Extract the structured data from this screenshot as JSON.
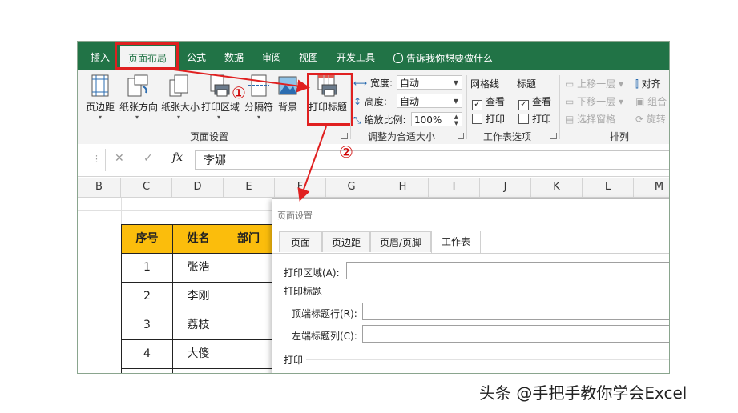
{
  "tabs": [
    {
      "label": "插入"
    },
    {
      "label": "页面布局"
    },
    {
      "label": "公式"
    },
    {
      "label": "数据"
    },
    {
      "label": "审阅"
    },
    {
      "label": "视图"
    },
    {
      "label": "开发工具"
    }
  ],
  "tell_me": "告诉我你想要做什么",
  "ribbon": {
    "page_setup": {
      "buttons": [
        {
          "label": "页边距"
        },
        {
          "label": "纸张方向"
        },
        {
          "label": "纸张大小"
        },
        {
          "label": "打印区域"
        },
        {
          "label": "分隔符"
        },
        {
          "label": "背景"
        },
        {
          "label": "打印标题"
        }
      ],
      "group_label": "页面设置"
    },
    "scale_to_fit": {
      "width_label": "宽度:",
      "width_value": "自动",
      "height_label": "高度:",
      "height_value": "自动",
      "scale_label": "缩放比例:",
      "scale_value": "100%",
      "group_label": "调整为合适大小"
    },
    "sheet_options": {
      "gridlines_label": "网格线",
      "headings_label": "标题",
      "view_label": "查看",
      "print_label": "打印",
      "gridlines_view": true,
      "gridlines_print": false,
      "headings_view": true,
      "headings_print": false,
      "group_label": "工作表选项"
    },
    "arrange": {
      "bring_forward": "上移一层",
      "send_backward": "下移一层",
      "selection_pane": "选择窗格",
      "align": "对齐",
      "group": "组合",
      "rotate": "旋转",
      "group_label": "排列"
    }
  },
  "formula_bar": {
    "cancel_icon": "✕",
    "enter_icon": "✓",
    "fx": "fx",
    "value": "李娜"
  },
  "columns": [
    "B",
    "C",
    "D",
    "E",
    "F",
    "G",
    "H",
    "I",
    "J",
    "K",
    "L",
    "M"
  ],
  "table": {
    "headers": [
      "序号",
      "姓名",
      "部门"
    ],
    "rows": [
      [
        "1",
        "张浩",
        ""
      ],
      [
        "2",
        "李刚",
        ""
      ],
      [
        "3",
        "荔枝",
        ""
      ],
      [
        "4",
        "大傻",
        ""
      ]
    ]
  },
  "dialog": {
    "title": "页面设置",
    "tabs": [
      "页面",
      "页边距",
      "页眉/页脚",
      "工作表"
    ],
    "print_area_label": "打印区域(A):",
    "print_titles_label": "打印标题",
    "rows_repeat_label": "顶端标题行(R):",
    "cols_repeat_label": "左端标题列(C):",
    "print_section_label": "打印"
  },
  "annotations": {
    "step1": "①",
    "step2": "②"
  },
  "colors": {
    "excel_green": "#217346",
    "highlight_red": "#e02020",
    "header_fill": "#fbbd0c"
  },
  "watermark": "头条 @手把手教你学会Excel"
}
